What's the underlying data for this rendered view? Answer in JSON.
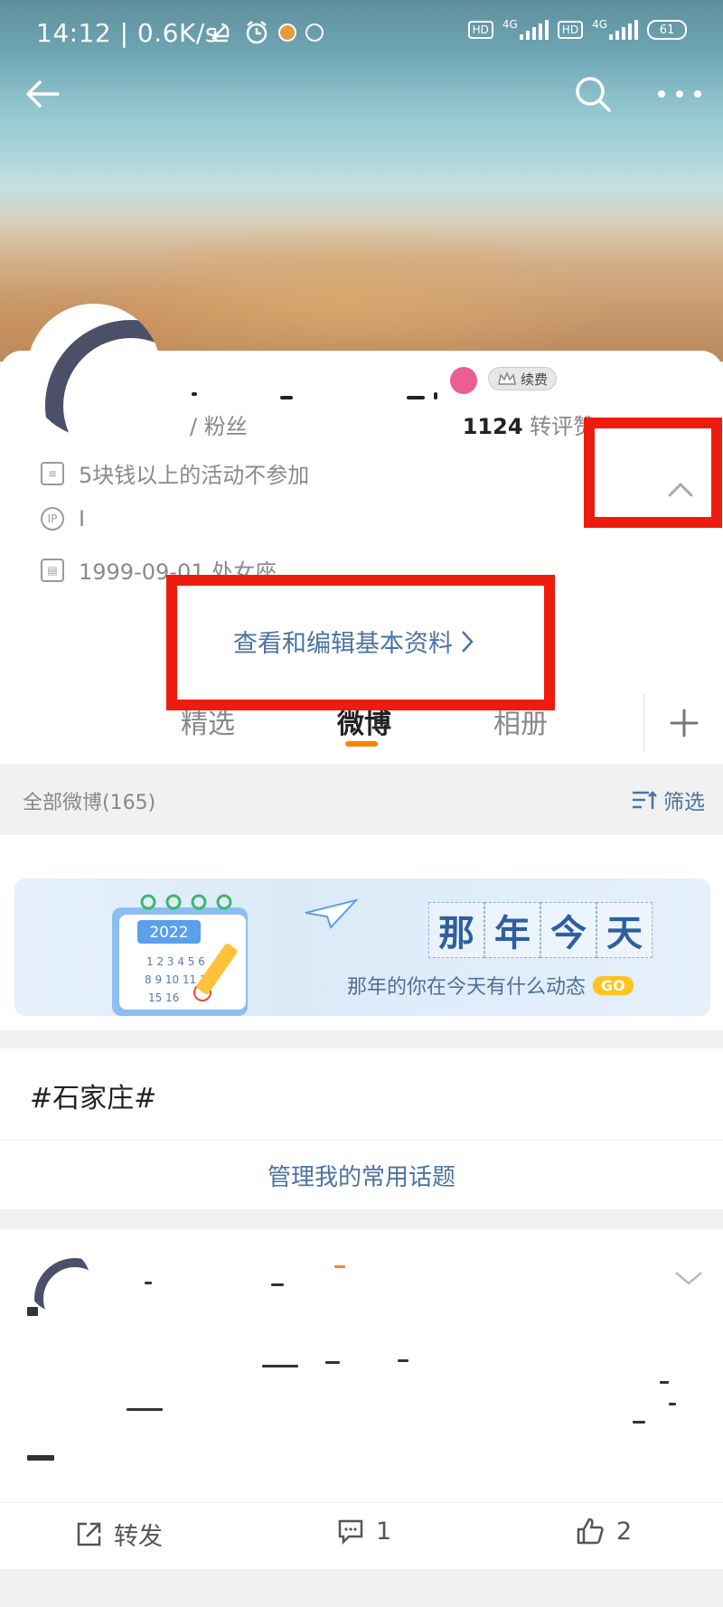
{
  "status_bar": {
    "time": "14:12 | 0.6K/s",
    "network_1": "4G",
    "network_2": "4G",
    "hd": "HD",
    "battery": "61"
  },
  "profile": {
    "stats_partial": "/ 粉丝",
    "interactions_value": "1124",
    "interactions_label": "转评赞",
    "membership_badge": "续费",
    "bio": "5块钱以上的活动不参加",
    "ip_label": "I",
    "birthday": "1999-09-01 处女座",
    "edit_link": "查看和编辑基本资料"
  },
  "tabs": [
    {
      "label": "精选"
    },
    {
      "label": "微博"
    },
    {
      "label": "相册"
    }
  ],
  "feed": {
    "count_label": "全部微博(165)",
    "filter_label": "筛选"
  },
  "banner": {
    "year": "2022",
    "title_chars": [
      "那",
      "年",
      "今",
      "天"
    ],
    "subtitle": "那年的你在今天有什么动态",
    "go": "GO"
  },
  "topics": {
    "tag": "#石家庄#",
    "manage": "管理我的常用话题"
  },
  "post": {
    "repost": "转发",
    "comments": "1",
    "likes": "2"
  },
  "colors": {
    "accent_orange": "#ff8200",
    "link_blue": "#4c73a3",
    "highlight_red": "#ee1c0e"
  }
}
